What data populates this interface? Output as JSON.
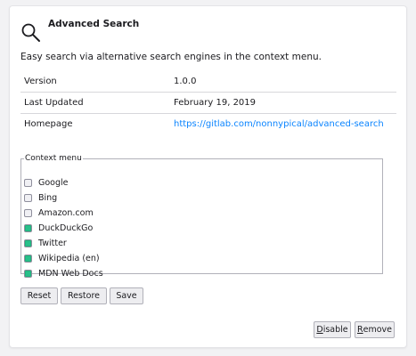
{
  "header": {
    "title": "Advanced Search",
    "description": "Easy search via alternative search engines in the context menu."
  },
  "details": [
    {
      "label": "Version",
      "value": "1.0.0",
      "is_link": false
    },
    {
      "label": "Last Updated",
      "value": "February 19, 2019",
      "is_link": false
    },
    {
      "label": "Homepage",
      "value": "https://gitlab.com/nonnypical/advanced-search",
      "is_link": true
    }
  ],
  "context_menu": {
    "legend": "Context menu",
    "options": [
      {
        "label": "Google",
        "checked": false
      },
      {
        "label": "Bing",
        "checked": false
      },
      {
        "label": "Amazon.com",
        "checked": false
      },
      {
        "label": "DuckDuckGo",
        "checked": true
      },
      {
        "label": "Twitter",
        "checked": true
      },
      {
        "label": "Wikipedia (en)",
        "checked": true
      },
      {
        "label": "MDN Web Docs",
        "checked": true
      }
    ]
  },
  "buttons": {
    "reset": "Reset",
    "restore": "Restore",
    "save": "Save",
    "disable_first": "D",
    "disable_rest": "isable",
    "remove_first": "R",
    "remove_rest": "emove"
  },
  "colors": {
    "accent": "#0a84ff",
    "checked": "#28c08a",
    "background": "#f2f2f4"
  }
}
